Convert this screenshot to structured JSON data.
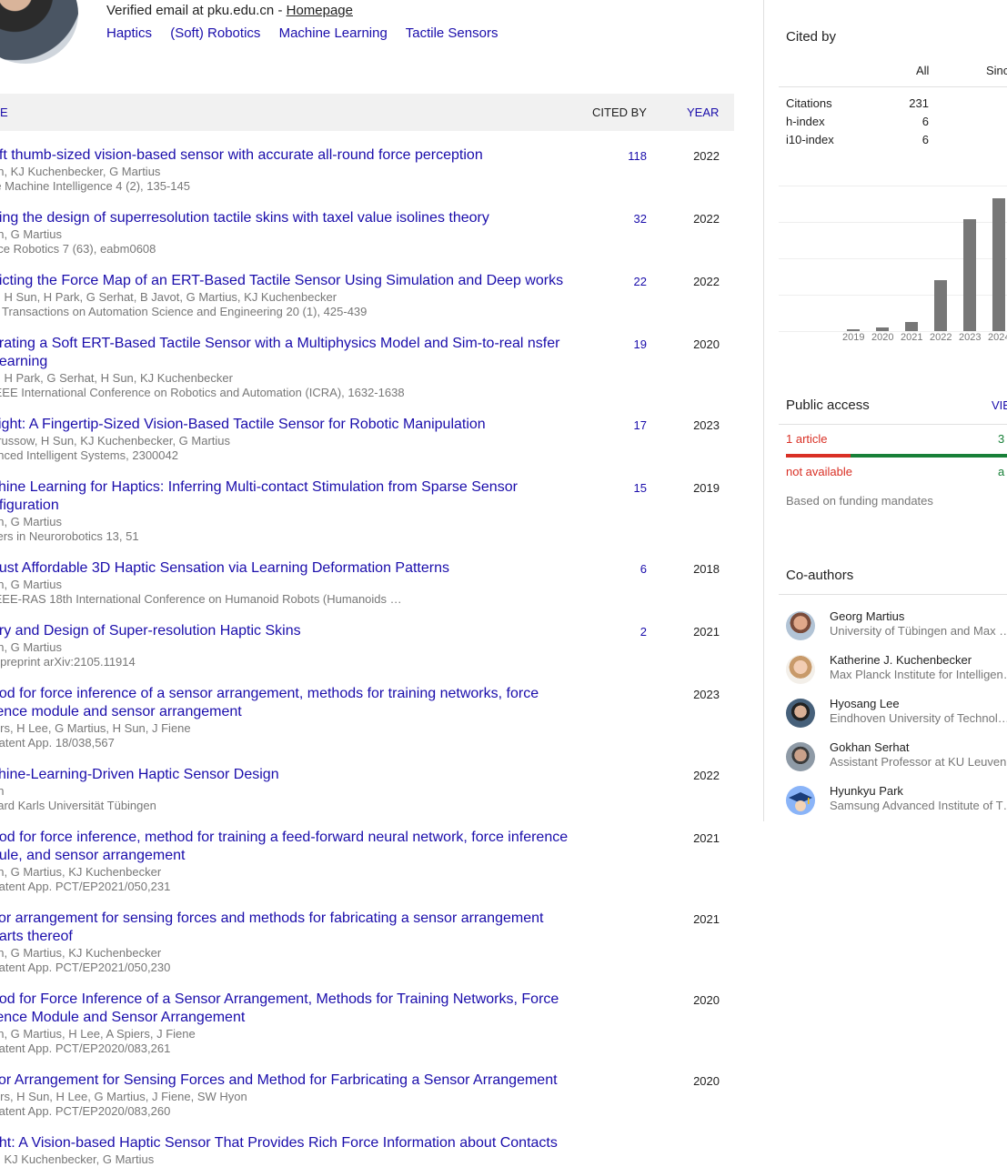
{
  "profile": {
    "verified_prefix": "Verified email at pku.edu.cn - ",
    "homepage_label": "Homepage",
    "interests": [
      "Haptics",
      "(Soft) Robotics",
      "Machine Learning",
      "Tactile Sensors"
    ]
  },
  "table": {
    "title_header": "E",
    "cited_header": "CITED BY",
    "year_header": "YEAR",
    "rows": [
      {
        "title": "oft thumb-sized vision-based sensor with accurate all-round force perception",
        "authors": "un, KJ Kuchenbecker, G Martius",
        "venue": "re Machine Intelligence 4 (2), 135-145",
        "cited": "118",
        "year": "2022"
      },
      {
        "title": "ding the design of superresolution tactile skins with taxel value isolines theory",
        "authors": "un, G Martius",
        "venue": "nce Robotics 7 (63), eabm0608",
        "cited": "32",
        "year": "2022"
      },
      {
        "title": "dicting the Force Map of an ERT-Based Tactile Sensor Using Simulation and Deep works",
        "authors": "e, H Sun, H Park, G Serhat, B Javot, G Martius, KJ Kuchenbecker",
        "venue": "E Transactions on Automation Science and Engineering 20 (1), 425-439",
        "cited": "22",
        "year": "2022"
      },
      {
        "title": "brating a Soft ERT-Based Tactile Sensor with a Multiphysics Model and Sim-to-real nsfer Learning",
        "authors": "e, H Park, G Serhat, H Sun, KJ Kuchenbecker",
        "venue": "IEEE International Conference on Robotics and Automation (ICRA), 1632-1638",
        "cited": "19",
        "year": "2020"
      },
      {
        "title": "sight: A Fingertip-Sized Vision-Based Tactile Sensor for Robotic Manipulation",
        "authors": "drussow, H Sun, KJ Kuchenbecker, G Martius",
        "venue": "anced Intelligent Systems, 2300042",
        "cited": "17",
        "year": "2023"
      },
      {
        "title": "chine Learning for Haptics: Inferring Multi-contact Stimulation from Sparse Sensor nfiguration",
        "authors": "un, G Martius",
        "venue": "tiers in Neurorobotics 13, 51",
        "cited": "15",
        "year": "2019"
      },
      {
        "title": "oust Affordable 3D Haptic Sensation via Learning Deformation Patterns",
        "authors": "un, G Martius",
        "venue": "IEEE-RAS 18th International Conference on Humanoid Robots (Humanoids …",
        "cited": "6",
        "year": "2018"
      },
      {
        "title": "ory and Design of Super-resolution Haptic Skins",
        "authors": "un, G Martius",
        "venue": "v preprint arXiv:2105.11914",
        "cited": "2",
        "year": "2021"
      },
      {
        "title": "hod for force inference of a sensor arrangement, methods for training networks, force rence module and sensor arrangement",
        "authors": "iers, H Lee, G Martius, H Sun, J Fiene",
        "venue": "Patent App. 18/038,567",
        "cited": "",
        "year": "2023"
      },
      {
        "title": "chine-Learning-Driven Haptic Sensor Design",
        "authors": "un",
        "venue": "hard Karls Universität Tübingen",
        "cited": "",
        "year": "2022"
      },
      {
        "title": "hod for force inference, method for training a feed-forward neural network, force inference dule, and sensor arrangement",
        "authors": "un, G Martius, KJ Kuchenbecker",
        "venue": "Patent App. PCT/EP2021/050,231",
        "cited": "",
        "year": "2021"
      },
      {
        "title": "sor arrangement for sensing forces and methods for fabricating a sensor arrangement parts thereof",
        "authors": "un, G Martius, KJ Kuchenbecker",
        "venue": "Patent App. PCT/EP2021/050,230",
        "cited": "",
        "year": "2021"
      },
      {
        "title": "hod for Force Inference of a Sensor Arrangement, Methods for Training Networks, Force rence Module and Sensor Arrangement",
        "authors": "un, G Martius, H Lee, A Spiers, J Fiene",
        "venue": "Patent App. PCT/EP2020/083,261",
        "cited": "",
        "year": "2020"
      },
      {
        "title": "sor Arrangement for Sensing Forces and Method for Farbricating a Sensor Arrangement",
        "authors": "iers, H Sun, H Lee, G Martius, J Fiene, SW Hyon",
        "venue": "Patent App. PCT/EP2020/083,260",
        "cited": "",
        "year": "2020"
      },
      {
        "title": "ght: A Vision-based Haptic Sensor That Provides Rich Force Information about Contacts",
        "authors": "n, KJ Kuchenbecker, G Martius",
        "venue": "",
        "cited": "",
        "year": ""
      }
    ]
  },
  "cited_by": {
    "title": "Cited by",
    "col_all": "All",
    "col_since": "Sinc",
    "metrics": [
      {
        "label": "Citations",
        "value": "231"
      },
      {
        "label": "h-index",
        "value": "6"
      },
      {
        "label": "i10-index",
        "value": "6"
      }
    ]
  },
  "chart_data": {
    "type": "bar",
    "categories": [
      "2019",
      "2020",
      "2021",
      "2022",
      "2023",
      "2024"
    ],
    "values": [
      2,
      5,
      13,
      70,
      154,
      183
    ],
    "ylim": [
      0,
      200
    ],
    "grid": true,
    "bar_color": "#777777"
  },
  "public_access": {
    "title": "Public access",
    "view_label": "VIE",
    "not_available_count": "1 article",
    "available_count": "3",
    "not_available_label": "not available",
    "available_label": "a",
    "note": "Based on funding mandates",
    "not_available_color": "#d93025",
    "available_color": "#188038"
  },
  "coauthors": {
    "title": "Co-authors",
    "items": [
      {
        "name": "Georg Martius",
        "affiliation": "University of Tübingen and Max …"
      },
      {
        "name": "Katherine J. Kuchenbecker",
        "affiliation": "Max Planck Institute for Intelligen…"
      },
      {
        "name": "Hyosang Lee",
        "affiliation": "Eindhoven University of Technol…"
      },
      {
        "name": "Gokhan Serhat",
        "affiliation": "Assistant Professor at KU Leuven"
      },
      {
        "name": "Hyunkyu Park",
        "affiliation": "Samsung Advanced Institute of T…"
      }
    ]
  }
}
